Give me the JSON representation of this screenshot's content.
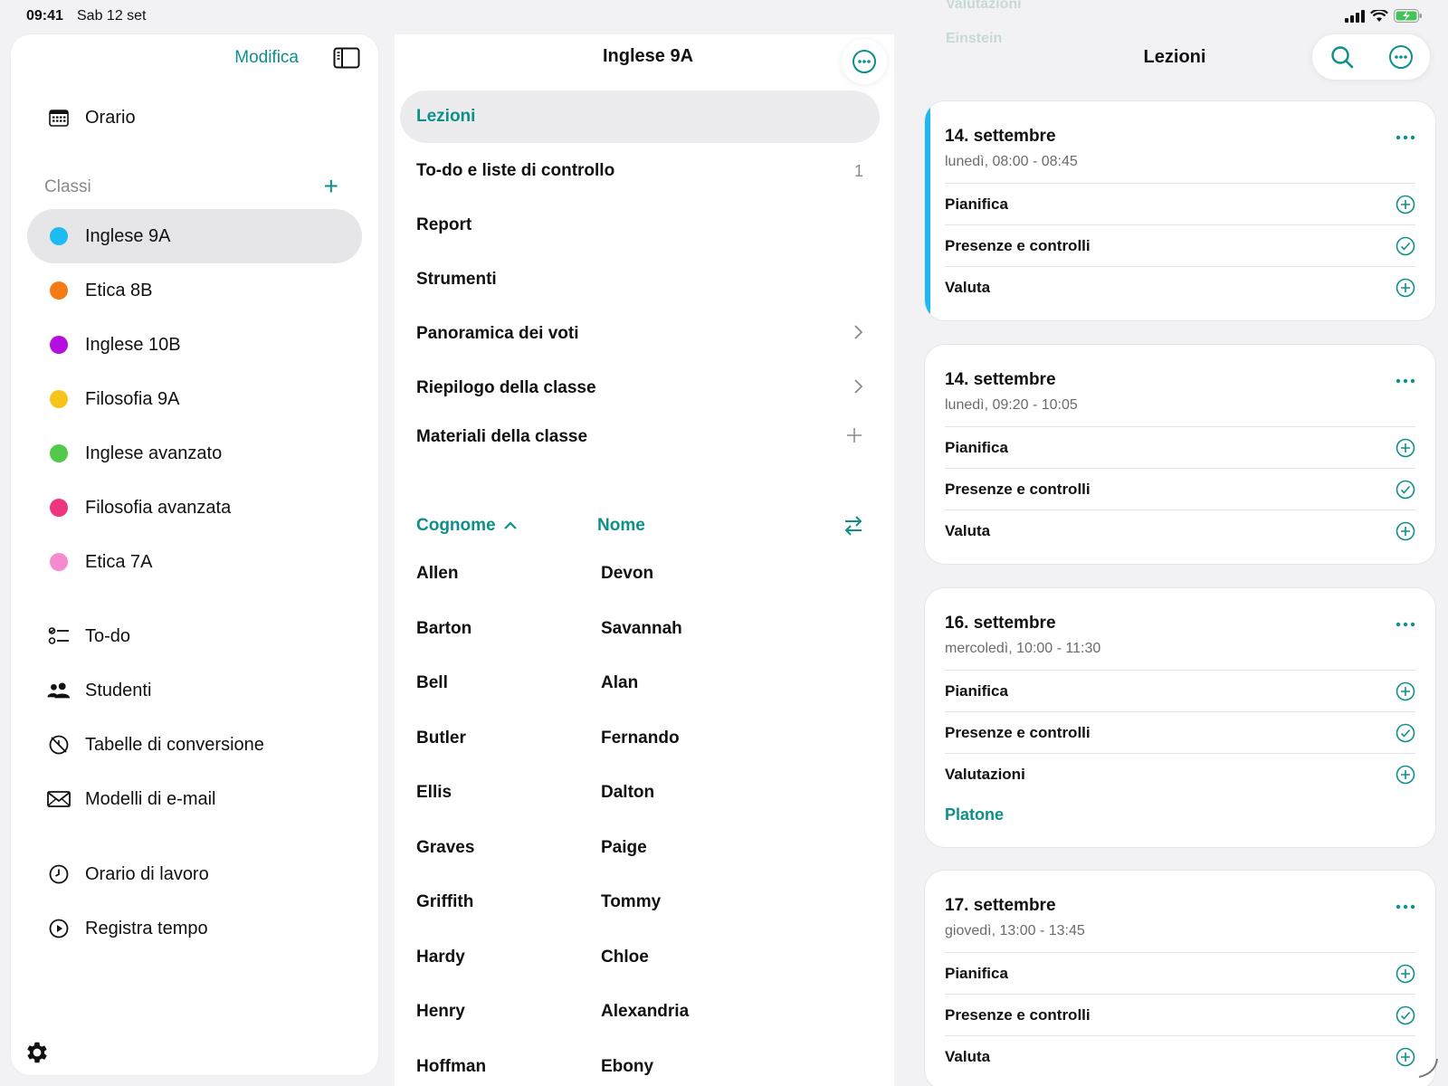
{
  "status_bar": {
    "time": "09:41",
    "date": "Sab 12 set"
  },
  "sidebar": {
    "edit_label": "Modifica",
    "schedule_label": "Orario",
    "classes_header": "Classi",
    "add_class_label": "+",
    "classes": [
      {
        "label": "Inglese 9A",
        "color": "#1cbcf2",
        "selected": true
      },
      {
        "label": "Etica 8B",
        "color": "#f57a14"
      },
      {
        "label": "Inglese 10B",
        "color": "#b40fe0"
      },
      {
        "label": "Filosofia 9A",
        "color": "#f7c51a"
      },
      {
        "label": "Inglese avanzato",
        "color": "#52c94b"
      },
      {
        "label": "Filosofia avanzata",
        "color": "#f0357f"
      },
      {
        "label": "Etica 7A",
        "color": "#f58ad0"
      }
    ],
    "tools": [
      {
        "label": "To-do",
        "icon": "checklist-icon"
      },
      {
        "label": "Studenti",
        "icon": "people-icon"
      },
      {
        "label": "Tabelle di conversione",
        "icon": "slashed-clock-icon"
      },
      {
        "label": "Modelli di e-mail",
        "icon": "envelope-icon"
      }
    ],
    "time_tools": [
      {
        "label": "Orario di lavoro",
        "icon": "clock-icon"
      },
      {
        "label": "Registra tempo",
        "icon": "play-circle-icon"
      }
    ]
  },
  "middle": {
    "title": "Inglese 9A",
    "menu": [
      {
        "label": "Lezioni",
        "selected": true,
        "trail": ""
      },
      {
        "label": "To-do e liste di controllo",
        "trail": "1"
      },
      {
        "label": "Report",
        "trail": ""
      },
      {
        "label": "Strumenti",
        "trail": ""
      },
      {
        "label": "Panoramica dei voti",
        "trail": "chevron"
      },
      {
        "label": "Riepilogo della classe",
        "trail": "chevron"
      },
      {
        "label": "Materiali della classe",
        "trail": "plus"
      }
    ],
    "sort": {
      "last_name": "Cognome",
      "first_name": "Nome"
    },
    "students": [
      {
        "last": "Allen",
        "first": "Devon"
      },
      {
        "last": "Barton",
        "first": "Savannah"
      },
      {
        "last": "Bell",
        "first": "Alan"
      },
      {
        "last": "Butler",
        "first": "Fernando"
      },
      {
        "last": "Ellis",
        "first": "Dalton"
      },
      {
        "last": "Graves",
        "first": "Paige"
      },
      {
        "last": "Griffith",
        "first": "Tommy"
      },
      {
        "last": "Hardy",
        "first": "Chloe"
      },
      {
        "last": "Henry",
        "first": "Alexandria"
      },
      {
        "last": "Hoffman",
        "first": "Ebony"
      }
    ]
  },
  "right": {
    "title": "Lezioni",
    "ghost_lines": [
      "Valutazioni",
      "Einstein"
    ],
    "lessons": [
      {
        "date": "14. settembre",
        "time": "lunedì, 08:00 - 08:45",
        "accent": true,
        "rows": [
          {
            "label": "Pianifica",
            "icon": "plus"
          },
          {
            "label": "Presenze e controlli",
            "icon": "check"
          },
          {
            "label": "Valuta",
            "icon": "plus"
          }
        ],
        "link": ""
      },
      {
        "date": "14. settembre",
        "time": "lunedì, 09:20 - 10:05",
        "rows": [
          {
            "label": "Pianifica",
            "icon": "plus"
          },
          {
            "label": "Presenze e controlli",
            "icon": "check"
          },
          {
            "label": "Valuta",
            "icon": "plus"
          }
        ],
        "link": ""
      },
      {
        "date": "16. settembre",
        "time": "mercoledì, 10:00 - 11:30",
        "rows": [
          {
            "label": "Pianifica",
            "icon": "plus"
          },
          {
            "label": "Presenze e controlli",
            "icon": "check"
          },
          {
            "label": "Valutazioni",
            "icon": "plus"
          }
        ],
        "link": "Platone"
      },
      {
        "date": "17. settembre",
        "time": "giovedì, 13:00 - 13:45",
        "rows": [
          {
            "label": "Pianifica",
            "icon": "plus"
          },
          {
            "label": "Presenze e controlli",
            "icon": "check"
          },
          {
            "label": "Valuta",
            "icon": "plus"
          }
        ],
        "link": ""
      }
    ]
  },
  "colors": {
    "accent": "#0e8f8a",
    "selected_bg": "#e6e6e8",
    "lesson_accent": "#1fb8f0"
  }
}
